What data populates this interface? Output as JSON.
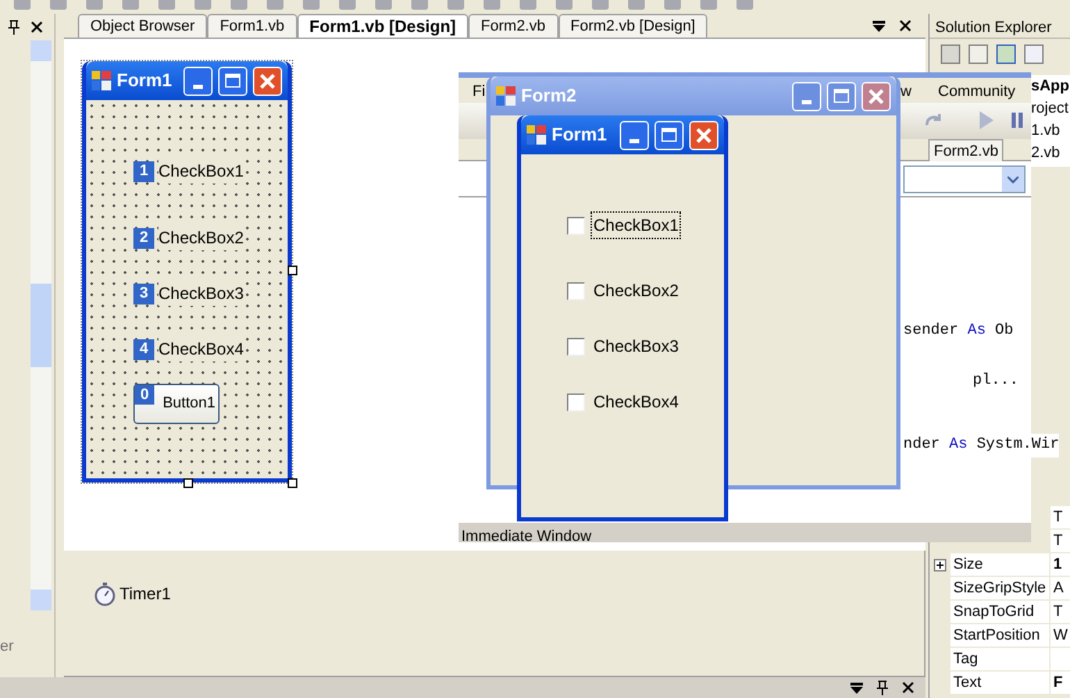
{
  "left_panel": {
    "footer_text": "er"
  },
  "document_tabs": [
    {
      "label": "Object Browser",
      "selected": false
    },
    {
      "label": "Form1.vb",
      "selected": false
    },
    {
      "label": "Form1.vb [Design]",
      "selected": true
    },
    {
      "label": "Form2.vb",
      "selected": false
    },
    {
      "label": "Form2.vb [Design]",
      "selected": false
    }
  ],
  "designer": {
    "form": {
      "title": "Form1",
      "controls": [
        {
          "kind": "checkbox",
          "tab_index": "1",
          "label": "CheckBox1"
        },
        {
          "kind": "checkbox",
          "tab_index": "2",
          "label": "CheckBox2"
        },
        {
          "kind": "checkbox",
          "tab_index": "3",
          "label": "CheckBox3"
        },
        {
          "kind": "checkbox",
          "tab_index": "4",
          "label": "CheckBox4"
        },
        {
          "kind": "button",
          "tab_index": "0",
          "label": "Button1"
        }
      ]
    },
    "tray": [
      {
        "label": "Timer1"
      }
    ]
  },
  "solution_explorer": {
    "title": "Solution Explorer",
    "items": [
      {
        "label": "sApp",
        "bold": true
      },
      {
        "label": "roject",
        "bold": false
      },
      {
        "label": "1.vb",
        "bold": false
      },
      {
        "label": "2.vb",
        "bold": false
      }
    ]
  },
  "properties": [
    {
      "value": "T",
      "bold": false
    },
    {
      "value": "T",
      "bold": false
    },
    {
      "name": "Size",
      "value": "1",
      "expandable": true,
      "bold": true
    },
    {
      "name": "SizeGripStyle",
      "value": "A",
      "expandable": false,
      "bold": false
    },
    {
      "name": "SnapToGrid",
      "value": "T",
      "expandable": false,
      "bold": false
    },
    {
      "name": "StartPosition",
      "value": "W",
      "expandable": false,
      "bold": false
    },
    {
      "name": "Tag",
      "expandable": false
    },
    {
      "name": "Text",
      "value": "F",
      "expandable": false,
      "bold": true
    }
  ],
  "background_ide": {
    "menu": [
      {
        "label": "Fi"
      },
      {
        "label": "w"
      },
      {
        "label": "Community"
      }
    ],
    "tabs": [
      {
        "label": "Form2.vb"
      }
    ],
    "code_lines": [
      {
        "tokens": [
          {
            "text": "sender ",
            "kind": "plain"
          },
          {
            "text": "As",
            "kind": "keyword"
          },
          {
            "text": " Ob",
            "kind": "plain"
          }
        ]
      },
      {
        "tokens": [
          {
            "text": "pl...",
            "kind": "plain"
          }
        ]
      },
      {
        "tokens": [
          {
            "text": "nder ",
            "kind": "plain"
          },
          {
            "text": "As",
            "kind": "keyword"
          },
          {
            "text": " Systm.Wir",
            "kind": "plain"
          }
        ]
      }
    ],
    "status_text": "Immediate Window"
  },
  "form2": {
    "title": "Form2",
    "active": false
  },
  "form1_runtime": {
    "title": "Form1",
    "active": true,
    "checkboxes": [
      {
        "label": "CheckBox1",
        "checked": false,
        "focused": true
      },
      {
        "label": "CheckBox2",
        "checked": false,
        "focused": false
      },
      {
        "label": "CheckBox3",
        "checked": false,
        "focused": false
      },
      {
        "label": "CheckBox4",
        "checked": false,
        "focused": false
      }
    ]
  }
}
